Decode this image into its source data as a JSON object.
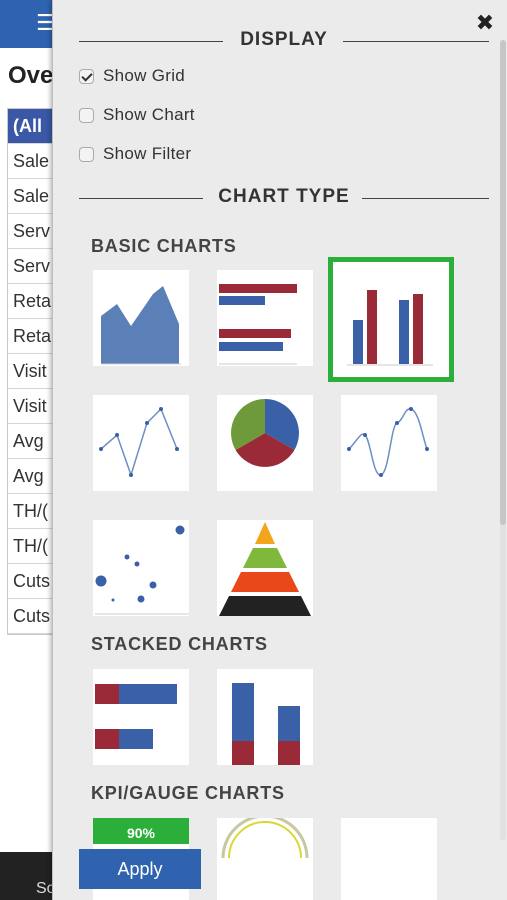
{
  "background": {
    "menu_icon": "☰",
    "page_title": "Ove",
    "list_items": [
      "(All",
      "Sale",
      "Sale",
      "Serv",
      "Serv",
      "Reta",
      "Reta",
      "Visit",
      "Visit",
      "Avg",
      "Avg",
      "TH/(",
      "TH/(",
      "Cuts",
      "Cuts"
    ],
    "bottom_text": "So"
  },
  "panel": {
    "close_glyph": "✖",
    "display_heading": "DISPLAY",
    "checkboxes": [
      {
        "label": "Show Grid",
        "checked": true
      },
      {
        "label": "Show Chart",
        "checked": false
      },
      {
        "label": "Show Filter",
        "checked": false
      }
    ],
    "chart_type_heading": "CHART TYPE",
    "basic_heading": "BASIC CHARTS",
    "basic_charts": [
      "area-chart-icon",
      "horizontal-bar-chart-icon",
      "column-chart-icon",
      "line-chart-icon",
      "pie-chart-icon",
      "spline-chart-icon",
      "scatter-chart-icon",
      "pyramid-chart-icon"
    ],
    "selected_chart": "column-chart-icon",
    "stacked_heading": "STACKED CHARTS",
    "stacked_charts": [
      "stacked-bar-icon",
      "stacked-column-icon"
    ],
    "kpi_heading": "KPI/GAUGE CHARTS",
    "kpi_charts": [
      "kpi-progress-icon",
      "gauge-icon",
      "kpi-blank-icon"
    ],
    "kpi_progress_text": "90%",
    "apply_label": "Apply"
  },
  "colors": {
    "blue": "#3a60a8",
    "red": "#9a2a37",
    "selected_border": "#2bae3a",
    "apply_bg": "#2f63b0"
  }
}
